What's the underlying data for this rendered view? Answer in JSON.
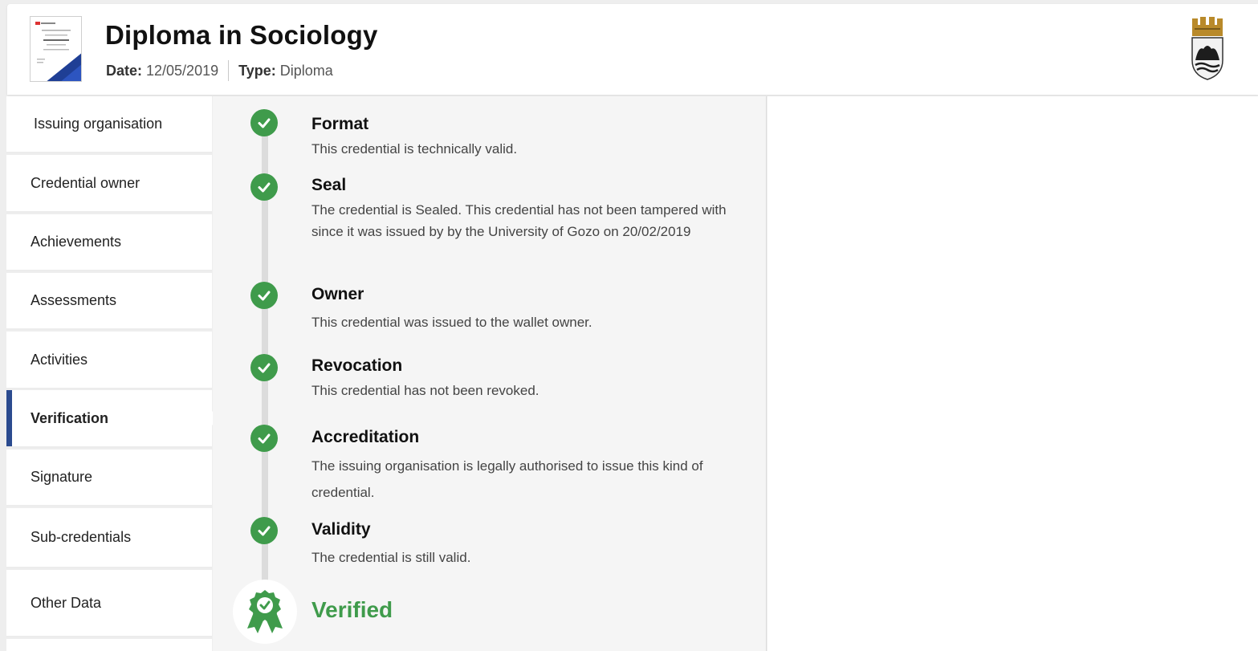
{
  "header": {
    "title": "Diploma in Sociology",
    "date_label": "Date:",
    "date_value": "12/05/2019",
    "type_label": "Type:",
    "type_value": "Diploma",
    "thumbnail_icon": "certificate-thumbnail",
    "crest_icon": "institution-crest-icon"
  },
  "sidebar": {
    "items": [
      {
        "label": "Issuing organisation"
      },
      {
        "label": "Credential owner"
      },
      {
        "label": "Achievements"
      },
      {
        "label": "Assessments"
      },
      {
        "label": "Activities"
      },
      {
        "label": "Verification",
        "active": true
      },
      {
        "label": "Signature"
      },
      {
        "label": "Sub-credentials"
      },
      {
        "label": "Other Data"
      }
    ]
  },
  "verification": {
    "steps": [
      {
        "title": "Format",
        "description": "This credential is technically valid.",
        "status": "passed"
      },
      {
        "title": "Seal",
        "description": "The credential is Sealed. This credential has not been tampered with since it was issued by by the University of Gozo on 20/02/2019",
        "status": "passed"
      },
      {
        "title": "Owner",
        "description": "This credential was issued to the wallet owner.",
        "status": "passed"
      },
      {
        "title": "Revocation",
        "description": "This credential has not been revoked.",
        "status": "passed"
      },
      {
        "title": "Accreditation",
        "description": "The issuing organisation is legally authorised to issue this kind of credential.",
        "status": "passed"
      },
      {
        "title": "Validity",
        "description": "The credential is still valid.",
        "status": "passed"
      }
    ],
    "result_label": "Verified",
    "colors": {
      "success": "#3f9b4b",
      "accent": "#2b4b8f"
    }
  }
}
